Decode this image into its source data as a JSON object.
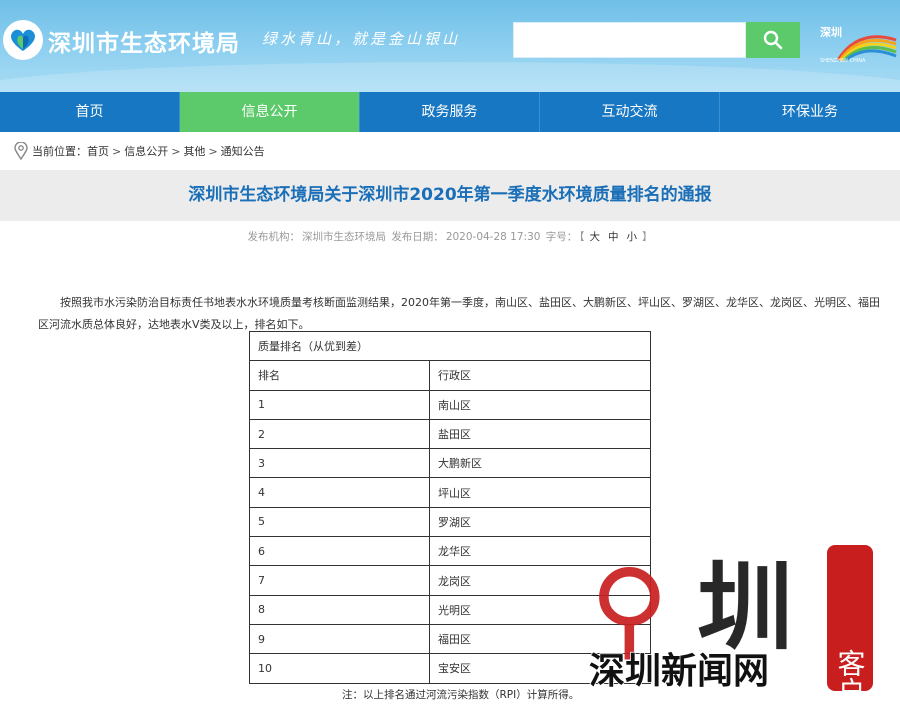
{
  "header": {
    "site_title": "深圳市生态环境局",
    "slogan": "绿水青山，就是金山银山",
    "search_placeholder": "",
    "partner_logo_text": "深圳 SHENZHEN CHINA"
  },
  "nav": {
    "items": [
      {
        "label": "首页"
      },
      {
        "label": "信息公开"
      },
      {
        "label": "政务服务"
      },
      {
        "label": "互动交流"
      },
      {
        "label": "环保业务"
      }
    ],
    "active_index": 1
  },
  "breadcrumb": {
    "prefix": "当前位置：",
    "items": [
      "首页",
      "信息公开",
      "其他",
      "通知公告"
    ],
    "separator": ">"
  },
  "article": {
    "title": "深圳市生态环境局关于深圳市2020年第一季度水环境质量排名的通报",
    "meta_org_label": "发布机构：",
    "meta_org": "深圳市生态环境局",
    "meta_date_label": "发布日期：",
    "meta_date": "2020-04-28 17:30",
    "meta_font_label": "字号：",
    "font_open": "【",
    "font_large": "大",
    "font_medium": "中",
    "font_small": "小",
    "font_close": "】",
    "paragraph": "按照我市水污染防治目标责任书地表水水环境质量考核断面监测结果，2020年第一季度，南山区、盐田区、大鹏新区、坪山区、罗湖区、龙华区、龙岗区、光明区、福田区河流水质总体良好，达地表水Ⅴ类及以上，排名如下。",
    "note": "注：以上排名通过河流污染指数（RPI）计算所得。"
  },
  "table": {
    "caption": "质量排名（从优到差）",
    "headers": [
      "排名",
      "行政区"
    ],
    "rows": [
      [
        "1",
        "南山区"
      ],
      [
        "2",
        "盐田区"
      ],
      [
        "3",
        "大鹏新区"
      ],
      [
        "4",
        "坪山区"
      ],
      [
        "5",
        "罗湖区"
      ],
      [
        "6",
        "龙华区"
      ],
      [
        "7",
        "龙岗区"
      ],
      [
        "8",
        "光明区"
      ],
      [
        "9",
        "福田区"
      ],
      [
        "10",
        "宝安区"
      ]
    ]
  },
  "watermark": {
    "big_char": "圳",
    "badge_text": "客户端",
    "bottom_text": "深圳新闻网"
  },
  "colors": {
    "header_bg": "#8fd0f0",
    "nav_bg": "#1877c2",
    "nav_active": "#5cc96a",
    "title_color": "#1a6fb8",
    "watermark_red": "#c81e1e"
  }
}
